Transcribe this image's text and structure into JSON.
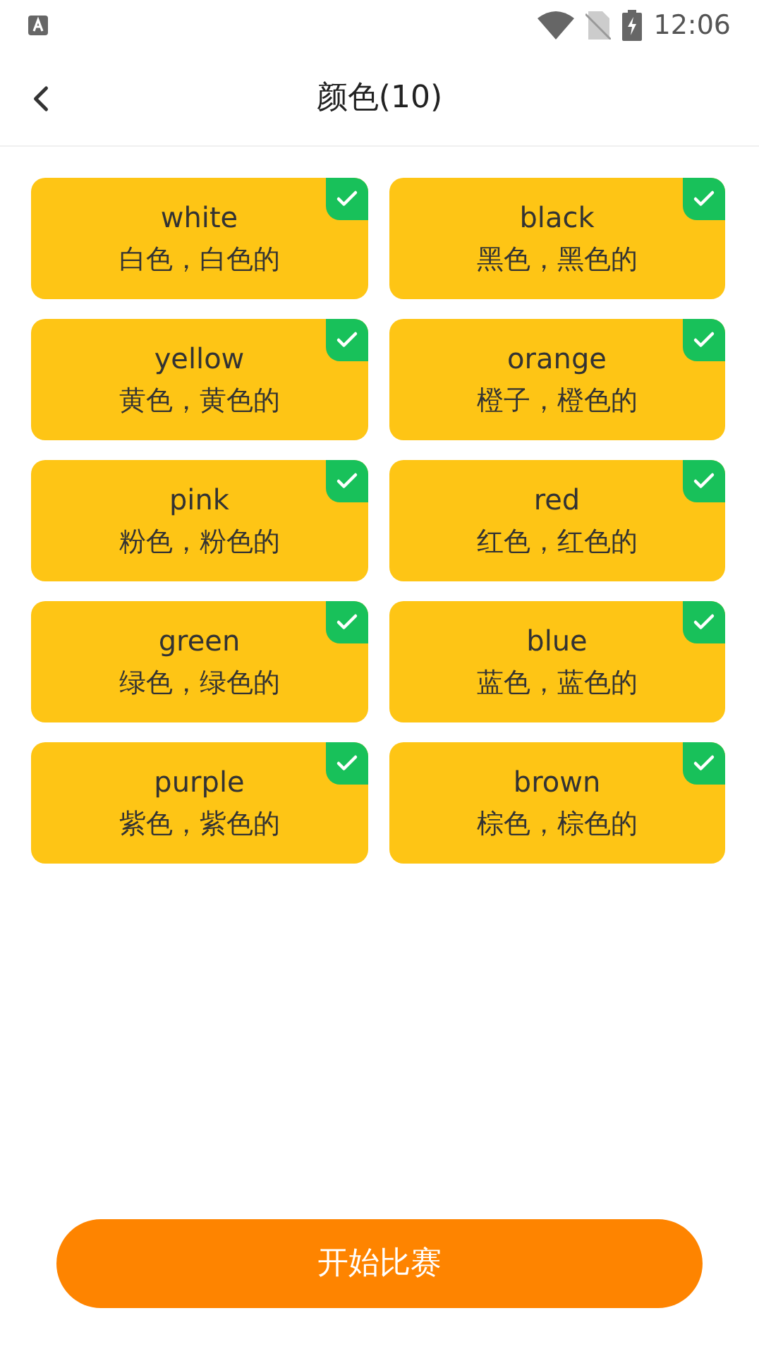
{
  "status_bar": {
    "time": "12:06"
  },
  "header": {
    "title": "颜色(10)"
  },
  "words": [
    {
      "word": "white",
      "meaning": "白色，白色的",
      "checked": true
    },
    {
      "word": "black",
      "meaning": "黑色，黑色的",
      "checked": true
    },
    {
      "word": "yellow",
      "meaning": "黄色，黄色的",
      "checked": true
    },
    {
      "word": "orange",
      "meaning": "橙子，橙色的",
      "checked": true
    },
    {
      "word": "pink",
      "meaning": "粉色，粉色的",
      "checked": true
    },
    {
      "word": "red",
      "meaning": "红色，红色的",
      "checked": true
    },
    {
      "word": "green",
      "meaning": "绿色，绿色的",
      "checked": true
    },
    {
      "word": "blue",
      "meaning": "蓝色，蓝色的",
      "checked": true
    },
    {
      "word": "purple",
      "meaning": "紫色，紫色的",
      "checked": true
    },
    {
      "word": "brown",
      "meaning": "棕色，棕色的",
      "checked": true
    }
  ],
  "start_button": "开始比赛"
}
